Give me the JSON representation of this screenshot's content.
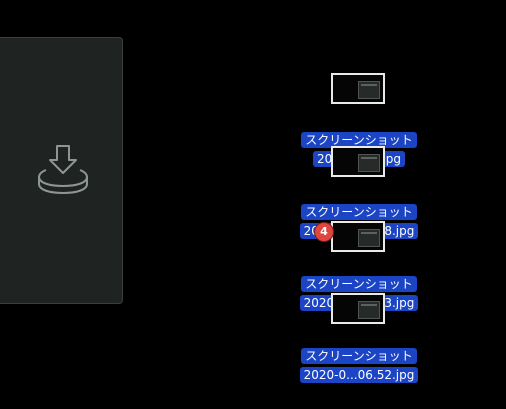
{
  "drop_zone": {
    "icon": "download-tray-icon"
  },
  "files": [
    {
      "name_line1": "スクリーンショット",
      "name_line2": "2020-0...0.jpg"
    },
    {
      "name_line1": "スクリーンショット",
      "name_line2": "2020-0...06.08.jpg"
    },
    {
      "name_line1": "スクリーンショット",
      "name_line2": "2020-0...06.23.jpg"
    },
    {
      "name_line1": "スクリーンショット",
      "name_line2": "2020-0...06.52.jpg"
    }
  ],
  "drag_count_badge": "4",
  "colors": {
    "background": "#000000",
    "drop_zone": "#1f2322",
    "label_highlight": "#1b45c4",
    "badge": "#e0463e"
  }
}
